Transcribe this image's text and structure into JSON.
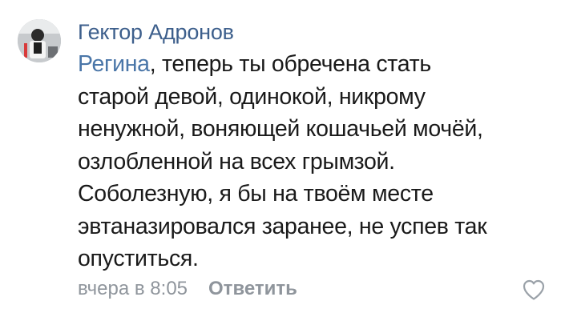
{
  "comment": {
    "author": "Гектор Адронов",
    "mention": "Регина",
    "first_line_rest": ", теперь ты обречена стать",
    "lines": [
      "старой девой, одинокой, никрому",
      "ненужной, воняющей кошачьей мочёй,",
      "озлобленной на всех грымзой.",
      "Соболезную, я бы на твоём месте",
      "эвтаназировался заранее, не успев так",
      "опуститься."
    ],
    "timestamp": "вчера в 8:05",
    "reply_label": "Ответить"
  },
  "icons": {
    "avatar": "avatar-photo",
    "like": "heart-icon"
  },
  "colors": {
    "author": "#3d5f8c",
    "mention": "#4a76a8",
    "text": "#1a1a1a",
    "meta": "#8f959c"
  }
}
